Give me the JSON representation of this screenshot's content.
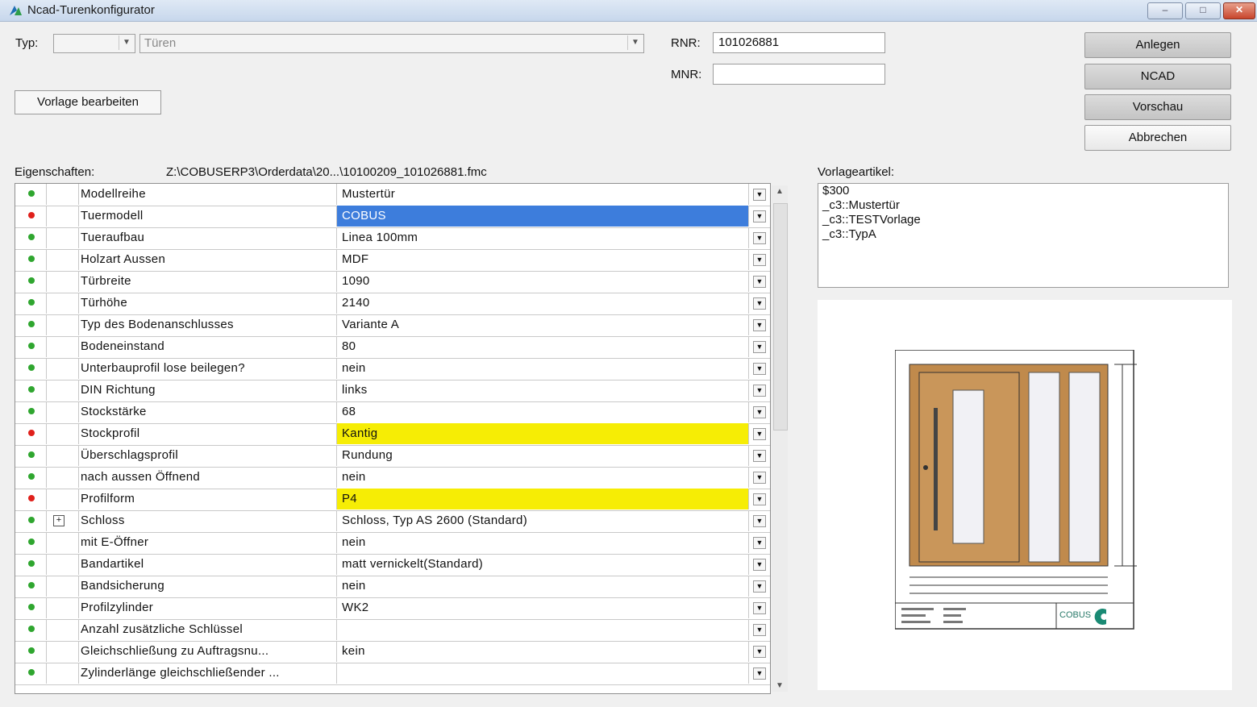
{
  "window": {
    "title": "Ncad-Turenkonfigurator",
    "controls": [
      "–",
      "□",
      "✕"
    ]
  },
  "form": {
    "typ_label": "Typ:",
    "typ_value": "",
    "turen_value": "Türen",
    "rnr_label": "RNR:",
    "rnr_value": "101026881",
    "mnr_label": "MNR:",
    "mnr_value": "",
    "vorlage_button": "Vorlage bearbeiten"
  },
  "actions": {
    "anlegen": "Anlegen",
    "ncad": "NCAD",
    "vorschau": "Vorschau",
    "abbrechen": "Abbrechen"
  },
  "properties": {
    "label": "Eigenschaften:",
    "path": "Z:\\COBUSERP3\\Orderdata\\20...\\10100209_101026881.fmc",
    "rows": [
      {
        "status": "green",
        "name": "Modellreihe",
        "value": "Mustertür",
        "hl": ""
      },
      {
        "status": "red",
        "name": "Tuermodell",
        "value": "COBUS",
        "hl": "blue"
      },
      {
        "status": "green",
        "name": "Tueraufbau",
        "value": "Linea 100mm",
        "hl": ""
      },
      {
        "status": "green",
        "name": "Holzart Aussen",
        "value": "MDF",
        "hl": ""
      },
      {
        "status": "green",
        "name": "Türbreite",
        "value": "1090",
        "hl": ""
      },
      {
        "status": "green",
        "name": "Türhöhe",
        "value": "2140",
        "hl": ""
      },
      {
        "status": "green",
        "name": "Typ des Bodenanschlusses",
        "value": "Variante A",
        "hl": ""
      },
      {
        "status": "green",
        "name": "Bodeneinstand",
        "value": "80",
        "hl": ""
      },
      {
        "status": "green",
        "name": "Unterbauprofil lose beilegen?",
        "value": "nein",
        "hl": ""
      },
      {
        "status": "green",
        "name": "DIN Richtung",
        "value": "links",
        "hl": ""
      },
      {
        "status": "green",
        "name": "Stockstärke",
        "value": "68",
        "hl": ""
      },
      {
        "status": "red",
        "name": "Stockprofil",
        "value": "Kantig",
        "hl": "yellow"
      },
      {
        "status": "green",
        "name": "Überschlagsprofil",
        "value": "Rundung",
        "hl": ""
      },
      {
        "status": "green",
        "name": "nach aussen Öffnend",
        "value": "nein",
        "hl": ""
      },
      {
        "status": "red",
        "name": "Profilform",
        "value": "P4",
        "hl": "yellow"
      },
      {
        "status": "green",
        "name": "Schloss",
        "value": "Schloss, Typ AS 2600 (Standard)",
        "hl": "",
        "expandable": true
      },
      {
        "status": "green",
        "name": "mit E-Öffner",
        "value": "nein",
        "hl": ""
      },
      {
        "status": "green",
        "name": "Bandartikel",
        "value": "matt vernickelt(Standard)",
        "hl": ""
      },
      {
        "status": "green",
        "name": "Bandsicherung",
        "value": "nein",
        "hl": ""
      },
      {
        "status": "green",
        "name": "Profilzylinder",
        "value": "WK2",
        "hl": ""
      },
      {
        "status": "green",
        "name": "Anzahl zusätzliche Schlüssel",
        "value": "",
        "hl": ""
      },
      {
        "status": "green",
        "name": "Gleichschließung zu Auftragsnu...",
        "value": "kein",
        "hl": ""
      },
      {
        "status": "green",
        "name": "Zylinderlänge gleichschließender ...",
        "value": "",
        "hl": ""
      }
    ]
  },
  "vorlage": {
    "label": "Vorlageartikel:",
    "lines": [
      "$300",
      "_c3::Mustertür",
      "_c3::TESTVorlage",
      "_c3::TypA"
    ]
  },
  "preview": {
    "logo_text": "COBUS"
  },
  "colors": {
    "status_green": "#2fa62f",
    "status_red": "#e0201b",
    "highlight_blue": "#3d7ddc",
    "highlight_yellow": "#f6ed05",
    "door_wood": "#c08a4c"
  }
}
